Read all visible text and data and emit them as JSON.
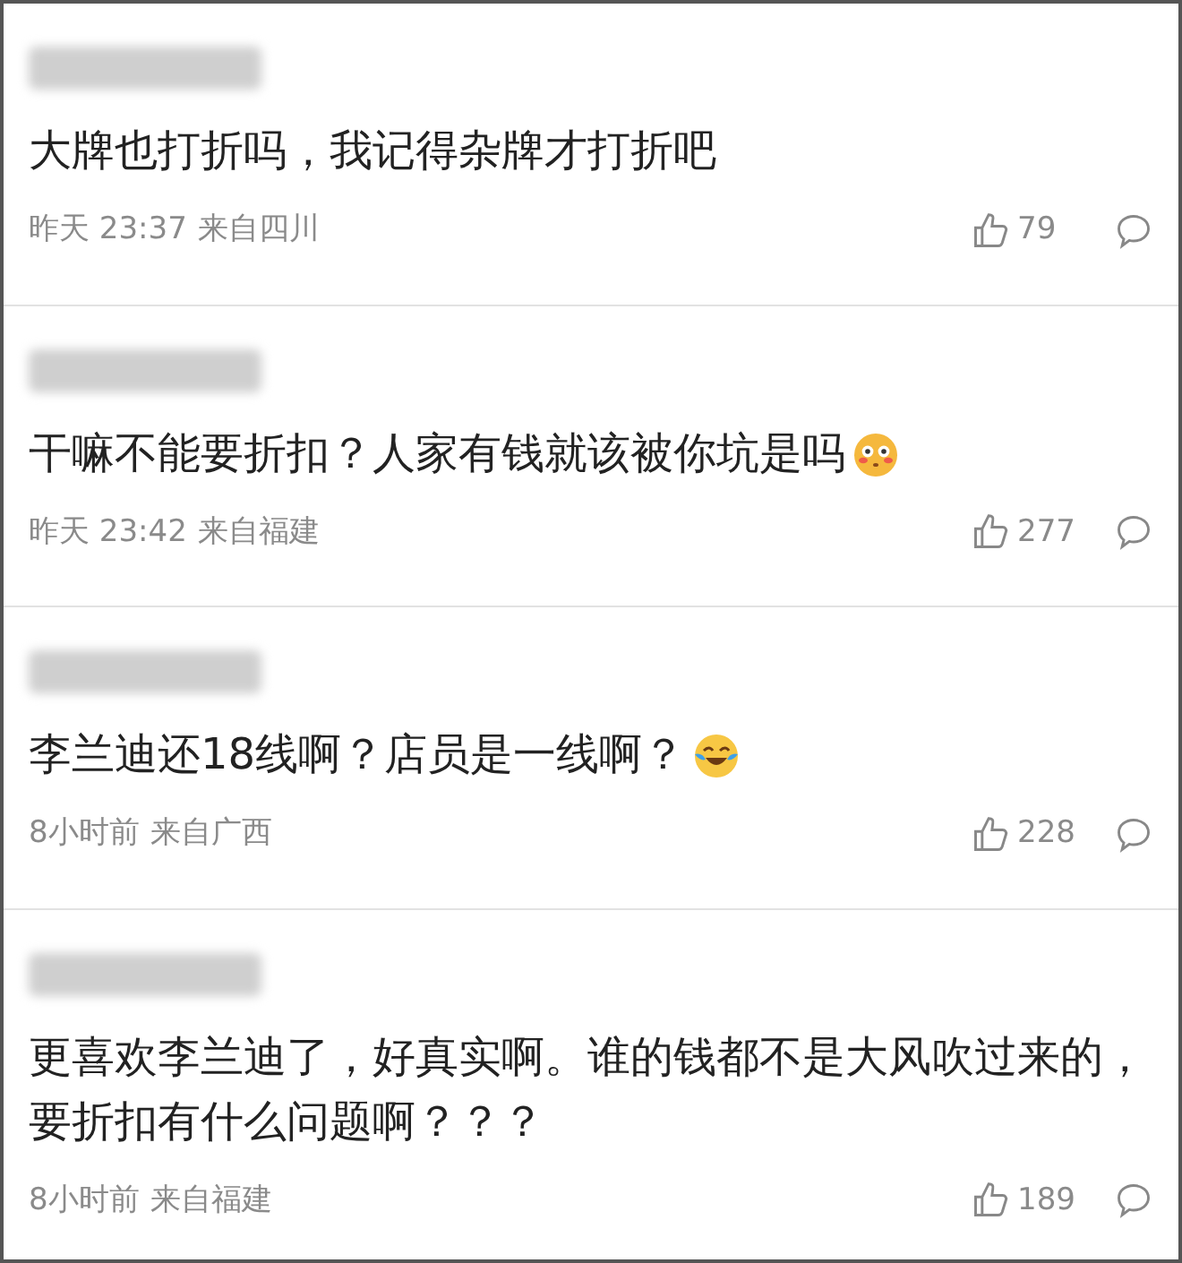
{
  "comments": [
    {
      "text": "大牌也打折吗，我记得杂牌才打折吧",
      "time": "昨天 23:37",
      "location": "来自四川",
      "likes": "79"
    },
    {
      "text": "干嘛不能要折扣？人家有钱就该被你坑是吗",
      "emoji": {
        "kind": "flushed"
      },
      "time": "昨天 23:42",
      "location": "来自福建",
      "likes": "277"
    },
    {
      "text": "李兰迪还18线啊？店员是一线啊？",
      "emoji": {
        "kind": "laughing-tears"
      },
      "time": "8小时前",
      "location": "来自广西",
      "likes": "228"
    },
    {
      "text": "更喜欢李兰迪了，好真实啊。谁的钱都不是大风吹过来的，要折扣有什么问题啊？？？",
      "time": "8小时前",
      "location": "来自福建",
      "likes": "189"
    }
  ]
}
